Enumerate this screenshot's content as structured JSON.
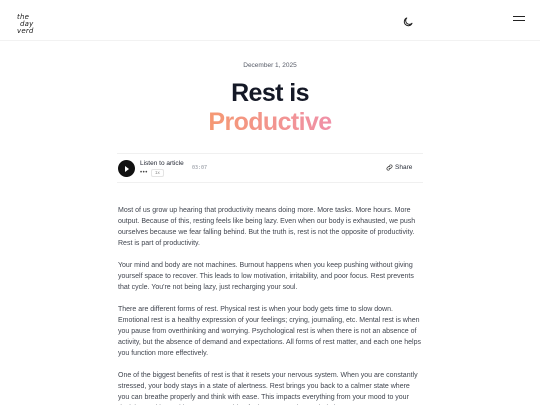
{
  "header": {
    "logo_lines": [
      "the",
      "day",
      "verd"
    ],
    "theme_icon": "moon-icon",
    "menu_icon": "hamburger-menu-icon"
  },
  "post": {
    "date": "December 1, 2025",
    "title_line1": "Rest is",
    "title_line2": "Productive"
  },
  "player": {
    "listen_label": "Listen to article",
    "more_label": "•••",
    "speed_label": "1x",
    "duration": "03:07",
    "share_label": "Share"
  },
  "article": {
    "paragraphs": [
      "Most of us grow up hearing that productivity means doing more. More tasks. More hours. More output. Because of this, resting feels like being lazy. Even when our body is exhausted, we push ourselves because we fear falling behind. But the truth is, rest is not the opposite of productivity. Rest is part of productivity.",
      "Your mind and body are not machines. Burnout happens when you keep pushing without giving yourself space to recover. This leads to low motivation, irritability, and poor focus. Rest prevents that cycle. You're not being lazy, just recharging your soul.",
      "There are different forms of rest. Physical rest is when your body gets time to slow down. Emotional rest is a healthy expression of your feelings; crying, journaling, etc. Mental rest is when you pause from overthinking and worrying. Psychological rest is when there is not an absence of activity, but the absence of demand and expectations. All forms of rest matter, and each one helps you function more effectively.",
      "One of the biggest benefits of rest is that it resets your nervous system. When you are constantly stressed, your body stays in a state of alertness. Rest brings you back to a calmer state where you can breathe properly and think with ease. This impacts everything from your mood to your decision-making. Without rest, everything feels urgent and overwhelming."
    ]
  },
  "colors": {
    "title_dark": "#141826",
    "gradient_start": "#f5b43e",
    "gradient_end": "#d88ae8"
  }
}
